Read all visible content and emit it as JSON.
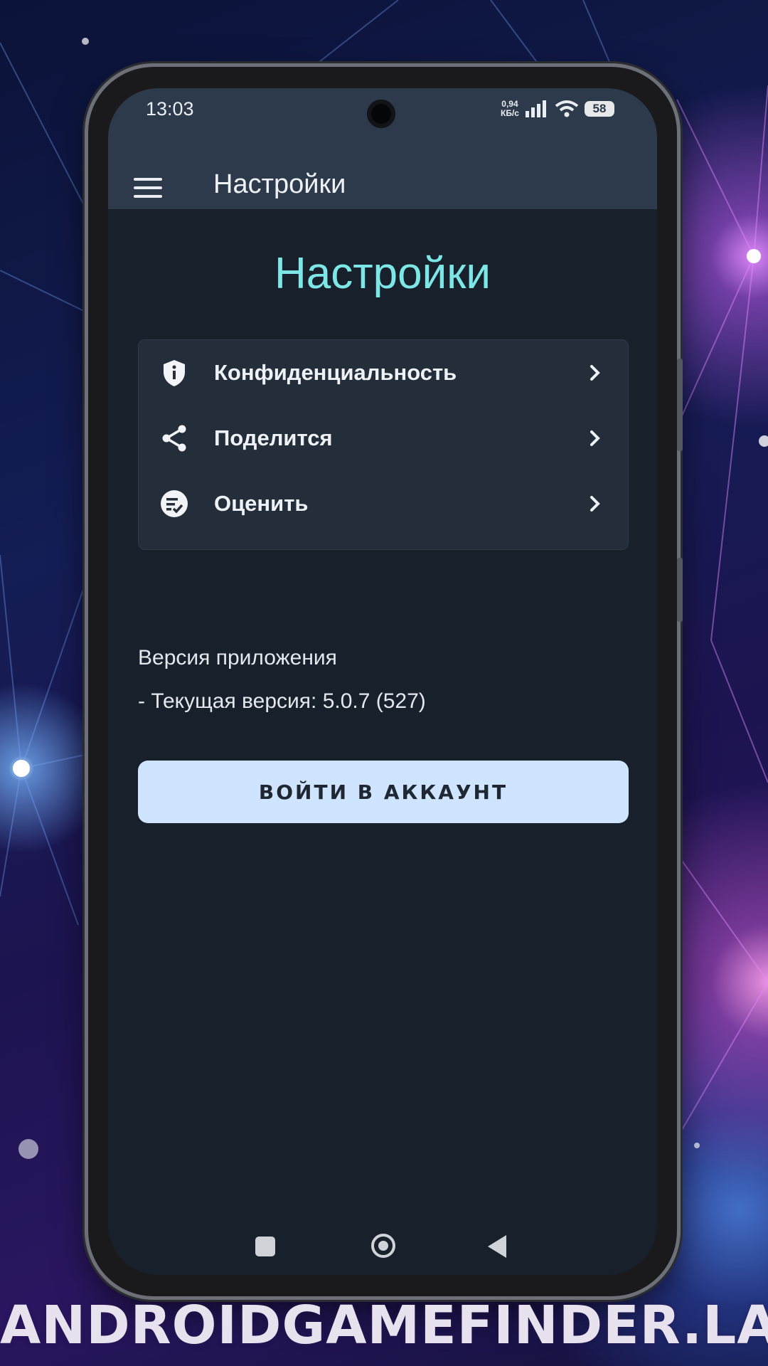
{
  "status_bar": {
    "time": "13:03",
    "net_speed_value": "0,94",
    "net_speed_unit": "КБ/с",
    "battery": "58",
    "icons": [
      "signal-icon",
      "wifi-icon",
      "battery-icon"
    ]
  },
  "app_bar": {
    "menu_icon": "hamburger-menu-icon",
    "title": "Настройки"
  },
  "main": {
    "heading": "Настройки",
    "menu_items": [
      {
        "label": "Конфиденциальность",
        "icon": "shield-info-icon"
      },
      {
        "label": "Поделится",
        "icon": "share-icon"
      },
      {
        "label": "Оценить",
        "icon": "rate-icon"
      }
    ],
    "version_title": "Версия приложения",
    "version_text": "- Текущая версия: 5.0.7 (527)",
    "login_button": "ВОЙТИ В АККАУНТ"
  },
  "nav_bar": {
    "icons": [
      "recent-apps-icon",
      "home-icon",
      "back-icon"
    ]
  },
  "watermark": "ANDROIDGAMEFINDER.LAT",
  "colors": {
    "app_bar": "#2c3a4b",
    "screen_bg": "#18212b",
    "card_bg": "#232e3a",
    "heading_accent": "#7de6e6",
    "button_bg": "#cfe4ff"
  }
}
